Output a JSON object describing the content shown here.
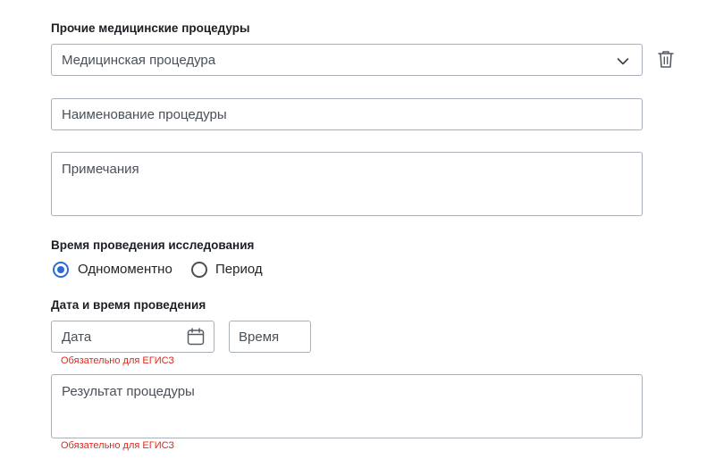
{
  "procedures_section": {
    "title": "Прочие медицинские процедуры",
    "procedure_select_value": "Медицинская процедура",
    "name_placeholder": "Наименование процедуры",
    "notes_placeholder": "Примечания"
  },
  "time_section": {
    "title": "Время проведения исследования",
    "options": [
      {
        "label": "Одномоментно",
        "checked": true
      },
      {
        "label": "Период",
        "checked": false
      }
    ]
  },
  "datetime_section": {
    "title": "Дата и время проведения",
    "date_placeholder": "Дата",
    "time_placeholder": "Время",
    "date_error": "Обязательно для ЕГИСЗ"
  },
  "result_section": {
    "result_placeholder": "Результат процедуры",
    "result_error": "Обязательно для ЕГИСЗ"
  },
  "icons": {
    "select_chevron": "chevron-down-icon",
    "delete": "trash-icon",
    "date_picker": "calendar-icon"
  },
  "colors": {
    "accent": "#2c6bd6",
    "error": "#e0281c",
    "border": "#a9b0b8"
  }
}
